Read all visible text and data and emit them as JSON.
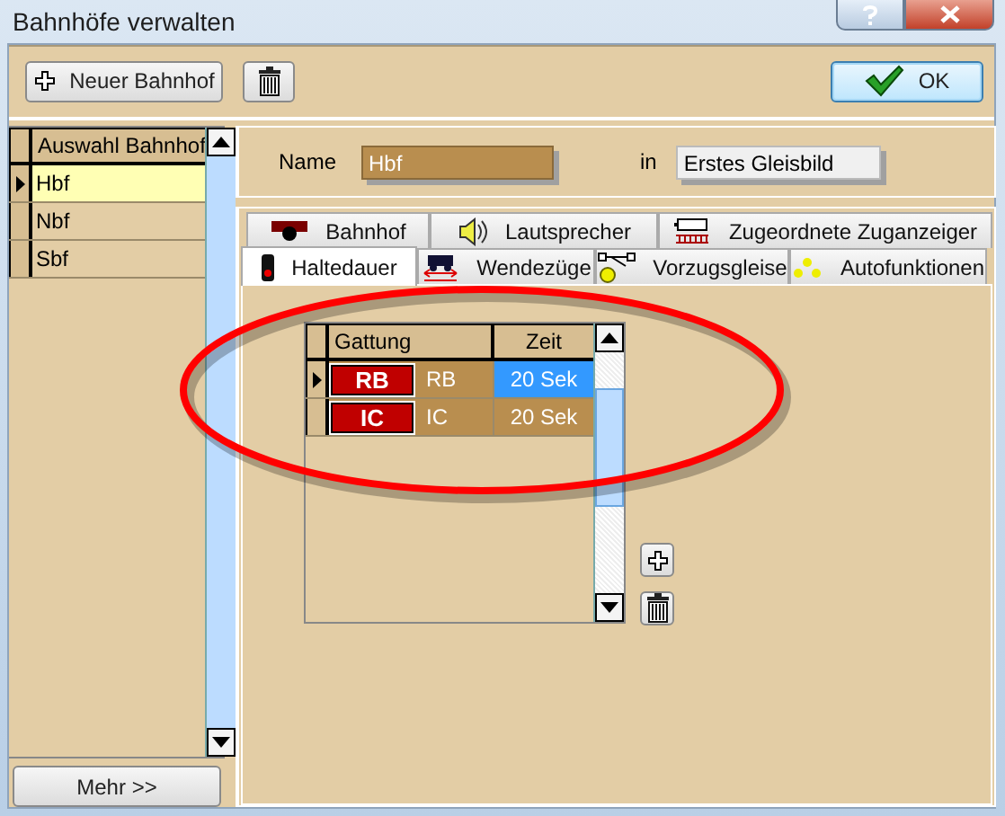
{
  "window": {
    "title": "Bahnhöfe verwalten"
  },
  "toolbar": {
    "new_button": "Neuer Bahnhof",
    "ok_button": "OK"
  },
  "station_list": {
    "header": "Auswahl Bahnhof",
    "items": [
      {
        "label": "Hbf",
        "selected": true
      },
      {
        "label": "Nbf",
        "selected": false
      },
      {
        "label": "Sbf",
        "selected": false
      }
    ],
    "more_button": "Mehr >>"
  },
  "station": {
    "name_label": "Name",
    "name_value": "Hbf",
    "in_label": "in",
    "in_value": "Erstes Gleisbild"
  },
  "tabs": [
    [
      {
        "label": "Bahnhof",
        "selected": false
      },
      {
        "label": "Lautsprecher",
        "selected": false
      },
      {
        "label": "Zugeordnete Zuganzeiger",
        "selected": false
      }
    ],
    [
      {
        "label": "Haltedauer",
        "selected": true
      },
      {
        "label": "Wendezüge",
        "selected": false
      },
      {
        "label": "Vorzugsgleise",
        "selected": false
      },
      {
        "label": "Autofunktionen",
        "selected": false
      }
    ]
  ],
  "table": {
    "columns": [
      "Gattung",
      "Zeit"
    ],
    "rows": [
      {
        "badge": "RB",
        "gattung": "RB",
        "zeit": "20 Sek",
        "selected": true
      },
      {
        "badge": "IC",
        "gattung": "IC",
        "zeit": "20 Sek",
        "selected": false
      }
    ]
  }
}
